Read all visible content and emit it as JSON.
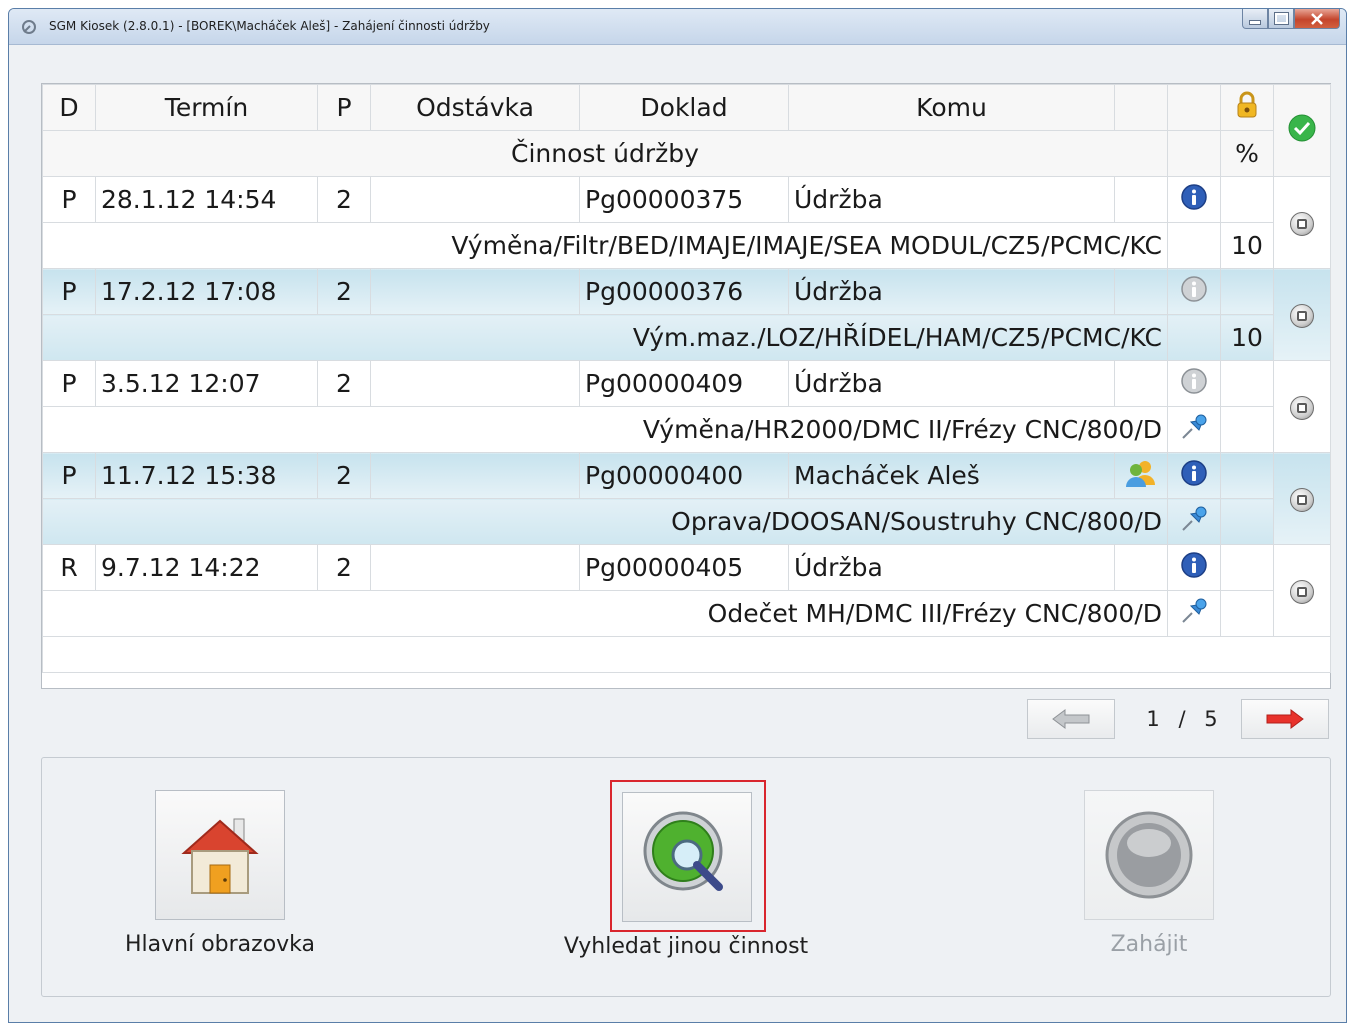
{
  "window": {
    "title": "SGM Kiosek (2.8.0.1) - [BOREK\\Macháček Aleš] - Zahájení činnosti údržby",
    "icon": "tool-icon",
    "controls": [
      "minimize-icon",
      "maximize-icon",
      "close-icon"
    ]
  },
  "grid": {
    "headers": {
      "d": "D",
      "termin": "Termín",
      "p": "P",
      "odstavka": "Odstávka",
      "doklad": "Doklad",
      "komu": "Komu",
      "subheader": "Činnost údržby",
      "percent": "%",
      "lock_icon": "lock-icon",
      "check_icon": "green-check-icon"
    },
    "rows": [
      {
        "d": "P",
        "termin": "28.1.12 14:54",
        "p": "2",
        "odstavka": "",
        "doklad": "Pg00000375",
        "komu": "Údržba",
        "activity": "Výměna/Filtr/BED/IMAJE/IMAJE/SEA MODUL/CZ5/PCMC/KC",
        "percent": "10",
        "info_icon": "info-icon-blue",
        "extra_icon": "",
        "highlight": false
      },
      {
        "d": "P",
        "termin": "17.2.12 17:08",
        "p": "2",
        "odstavka": "",
        "doklad": "Pg00000376",
        "komu": "Údržba",
        "activity": "Vým.maz./LOZ/HŘÍDEL/HAM/CZ5/PCMC/KC",
        "percent": "10",
        "info_icon": "info-icon-gray",
        "extra_icon": "",
        "highlight": true
      },
      {
        "d": "P",
        "termin": "3.5.12 12:07",
        "p": "2",
        "odstavka": "",
        "doklad": "Pg00000409",
        "komu": "Údržba",
        "activity": "Výměna/HR2000/DMC II/Frézy CNC/800/D",
        "percent": "",
        "info_icon": "info-icon-gray",
        "extra_icon": "pin-icon",
        "highlight": false
      },
      {
        "d": "P",
        "termin": "11.7.12 15:38",
        "p": "2",
        "odstavka": "",
        "doklad": "Pg00000400",
        "komu": "Macháček Aleš",
        "activity": "Oprava/DOOSAN/Soustruhy CNC/800/D",
        "percent": "",
        "info_icon": "info-icon-blue",
        "extra_icon": "pin-icon",
        "highlight": true,
        "users_icon": "users-icon"
      },
      {
        "d": "R",
        "termin": "9.7.12 14:22",
        "p": "2",
        "odstavka": "",
        "doklad": "Pg00000405",
        "komu": "Údržba",
        "activity": "Odečet MH/DMC III/Frézy CNC/800/D",
        "percent": "",
        "info_icon": "info-icon-blue",
        "extra_icon": "pin-icon",
        "highlight": false
      }
    ]
  },
  "pager": {
    "current": "1",
    "separator": "/",
    "total": "5",
    "prev_icon": "arrow-left-icon",
    "next_icon": "arrow-right-icon"
  },
  "actions": {
    "home": {
      "label": "Hlavní obrazovka",
      "icon": "house-icon"
    },
    "search": {
      "label": "Vyhledat jinou činnost",
      "icon": "magnifier-icon"
    },
    "start": {
      "label": "Zahájit",
      "icon": "gray-circle-icon",
      "disabled": true
    }
  },
  "colors": {
    "focus": "#d9262e",
    "row_highlight": "#cfe7f0",
    "info_blue": "#2f5fb8"
  }
}
